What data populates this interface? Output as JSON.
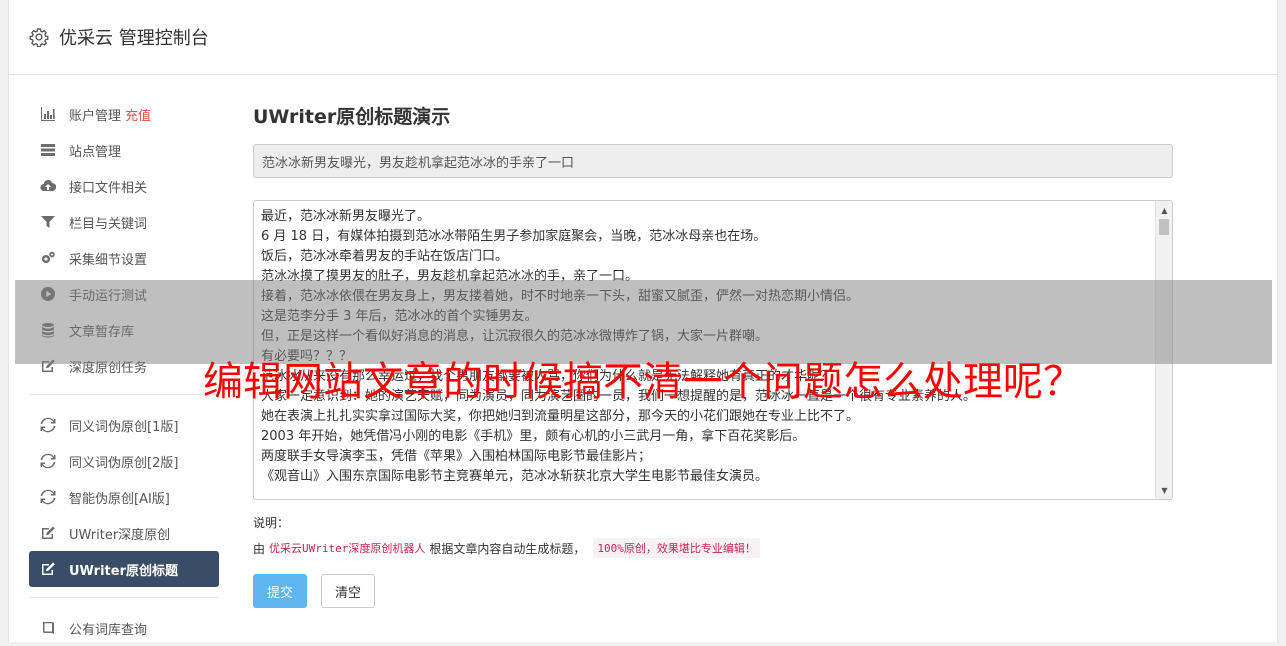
{
  "app": {
    "title": "优采云 管理控制台"
  },
  "sidebar": {
    "group1": [
      {
        "label": "账户管理",
        "accent": "充值",
        "icon": "bar-chart-icon"
      },
      {
        "label": "站点管理",
        "icon": "server-icon"
      },
      {
        "label": "接口文件相关",
        "icon": "cloud-upload-icon"
      },
      {
        "label": "栏目与关键词",
        "icon": "filter-icon"
      },
      {
        "label": "采集细节设置",
        "icon": "cogs-icon"
      },
      {
        "label": "手动运行测试",
        "icon": "play-circle-icon"
      },
      {
        "label": "文章暂存库",
        "icon": "database-icon"
      },
      {
        "label": "深度原创任务",
        "icon": "edit-icon"
      }
    ],
    "group2": [
      {
        "label": "同义词伪原创[1版]",
        "icon": "refresh-icon"
      },
      {
        "label": "同义词伪原创[2版]",
        "icon": "refresh-icon"
      },
      {
        "label": "智能伪原创[AI版]",
        "icon": "refresh-icon"
      },
      {
        "label": "UWriter深度原创",
        "icon": "edit-icon"
      },
      {
        "label": "UWriter原创标题",
        "icon": "edit-icon",
        "active": true
      }
    ],
    "group3": [
      {
        "label": "公有词库查询",
        "icon": "book-icon"
      }
    ]
  },
  "main": {
    "title": "UWriter原创标题演示",
    "title_value": "范冰冰新男友曝光，男友趁机拿起范冰冰的手亲了一口",
    "content_lines": [
      "最近，范冰冰新男友曝光了。",
      "6 月 18 日，有媒体拍摄到范冰冰带陌生男子参加家庭聚会，当晚，范冰冰母亲也在场。",
      "饭后，范冰冰牵着男友的手站在饭店门口。",
      "范冰冰摸了摸男友的肚子，男友趁机拿起范冰冰的手，亲了一口。",
      "接着，范冰冰依偎在男友身上，男友搂着她，时不时地亲一下头，甜蜜又腻歪，俨然一对热恋期小情侣。",
      "这是范李分手 3 年后，范冰冰的首个实锤男友。",
      "但，正是这样一个看似好消息的消息，让沉寂很久的范冰冰微博炸了锅，大家一片群嘲。",
      "有必要吗？？？",
      "范冰冰从来没有那么幸运过，找个男朋友都要被人骂，你们为什么就是无法解释她有真正的才华呢？",
      "大家一定意识到：她的演艺天赋，同为演员，同为演艺圈的一员，我们一想提醒的是，范冰冰一直是一个很有专业素养的人。",
      "她在表演上扎扎实实拿过国际大奖，你把她归到流量明星这部分，那今天的小花们跟她在专业上比不了。",
      "2003 年开始，她凭借冯小刚的电影《手机》里，颇有心机的小三武月一角，拿下百花奖影后。",
      "两度联手女导演李玉，凭借《苹果》入围柏林国际电影节最佳影片；",
      "《观音山》入围东京国际电影节主竞赛单元，范冰冰斩获北京大学生电影节最佳女演员。"
    ],
    "note_label": "说明：",
    "note_prefix": "由",
    "note_robot": "优采云UWriter深度原创机器人",
    "note_middle": "根据文章内容自动生成标题，",
    "note_badge": "100%原创，效果堪比专业编辑！",
    "submit_label": "提交",
    "clear_label": "清空"
  },
  "overlay": {
    "text": "编辑网站文章的时候搞不清一个问题怎么处理呢？"
  },
  "colors": {
    "accent": "#d9534f",
    "active_nav": "#3a4d66",
    "primary_button": "#5eb5f0",
    "overlay_text": "#ff0000"
  }
}
